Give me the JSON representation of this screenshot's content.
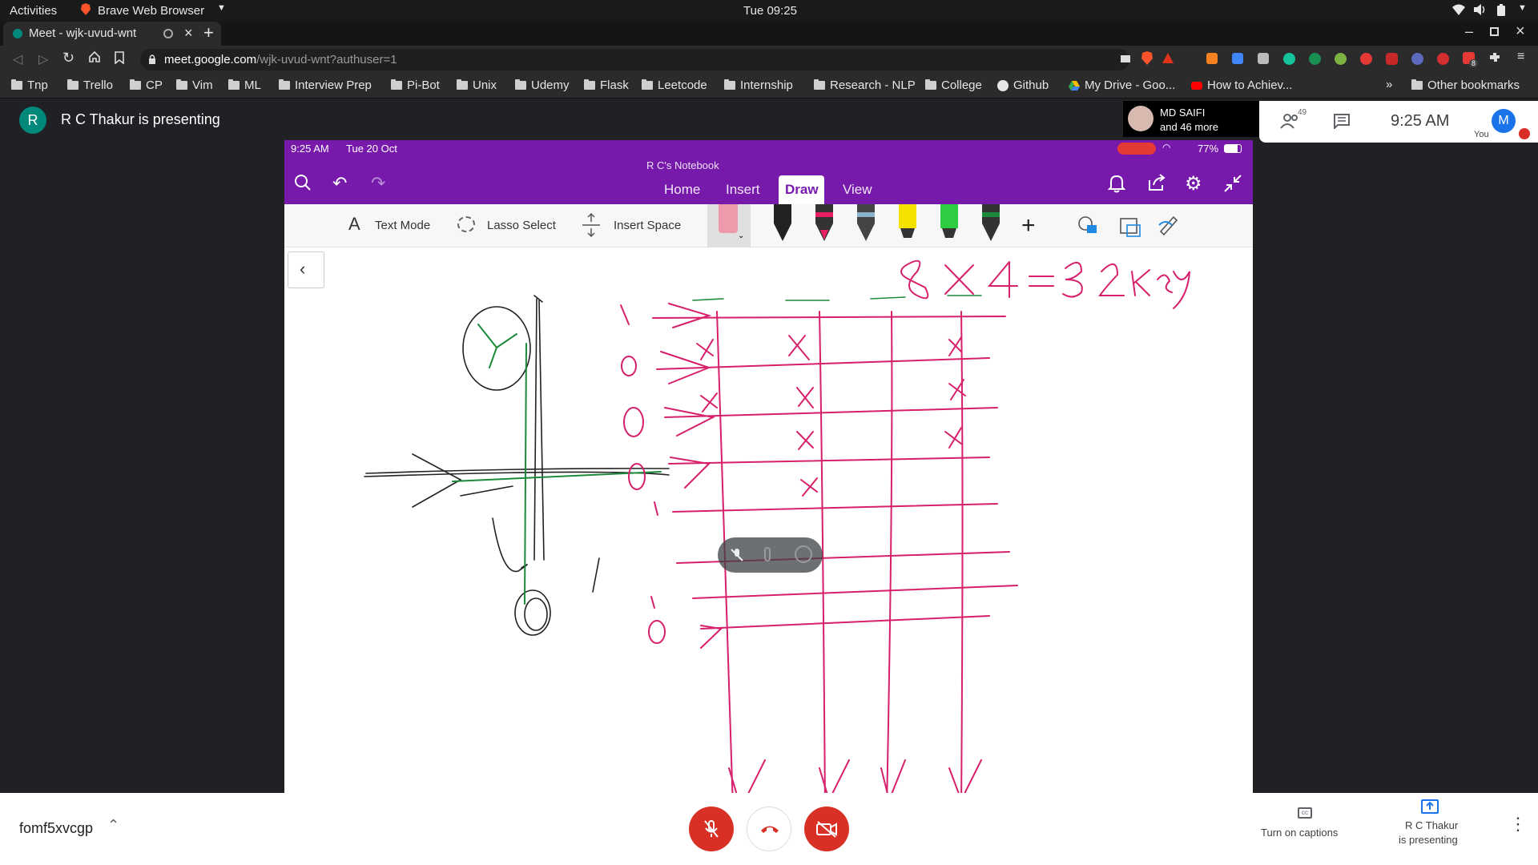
{
  "gnome": {
    "activities": "Activities",
    "app_name": "Brave Web Browser",
    "clock": "Tue 09:25"
  },
  "browser": {
    "tab_title": "Meet - wjk-uvud-wnt",
    "url_host": "meet.google.com",
    "url_path": "/wjk-uvud-wnt?authuser=1",
    "extension_badge": "8",
    "bookmarks": [
      "Tnp",
      "Trello",
      "CP",
      "Vim",
      "ML",
      "Interview Prep",
      "Pi-Bot",
      "Unix",
      "Udemy",
      "Flask",
      "Leetcode",
      "Internship",
      "Research - NLP",
      "College",
      "Github",
      "My Drive - Goo...",
      "How to Achiev..."
    ],
    "other_bookmarks": "Other bookmarks",
    "overflow": "»"
  },
  "meet": {
    "presenter_initial": "R",
    "presenting_label": "R C Thakur is presenting",
    "participant_name": "MD SAIFI",
    "participant_more": "and 46 more",
    "people_count": "49",
    "time": "9:25 AM",
    "self_initial": "M",
    "self_label": "You",
    "meeting_code": "fomf5xvcgp",
    "captions_label": "Turn on captions",
    "presenting_line1": "R C Thakur",
    "presenting_line2": "is presenting",
    "colors": {
      "end_call": "#d93025",
      "muted": "#d93025",
      "avatar_presenter": "#00897b",
      "avatar_self": "#1a73e8"
    }
  },
  "ipad": {
    "status_time": "9:25 AM",
    "status_date": "Tue 20 Oct",
    "battery": "77%",
    "notebook_title": "R C's Notebook",
    "tabs": [
      "Home",
      "Insert",
      "Draw",
      "View"
    ],
    "active_tab": "Draw",
    "tools": {
      "text_mode": "Text Mode",
      "lasso": "Lasso Select",
      "insert_space": "Insert Space"
    },
    "handwriting": "8 X 4 = 32 key",
    "left_margin_digits": [
      "1",
      "0",
      "0",
      "0",
      "1",
      "1",
      "0"
    ],
    "colors": {
      "header": "#7719aa",
      "ink_pink": "#d6206b",
      "ink_green": "#1c8a3a"
    }
  }
}
